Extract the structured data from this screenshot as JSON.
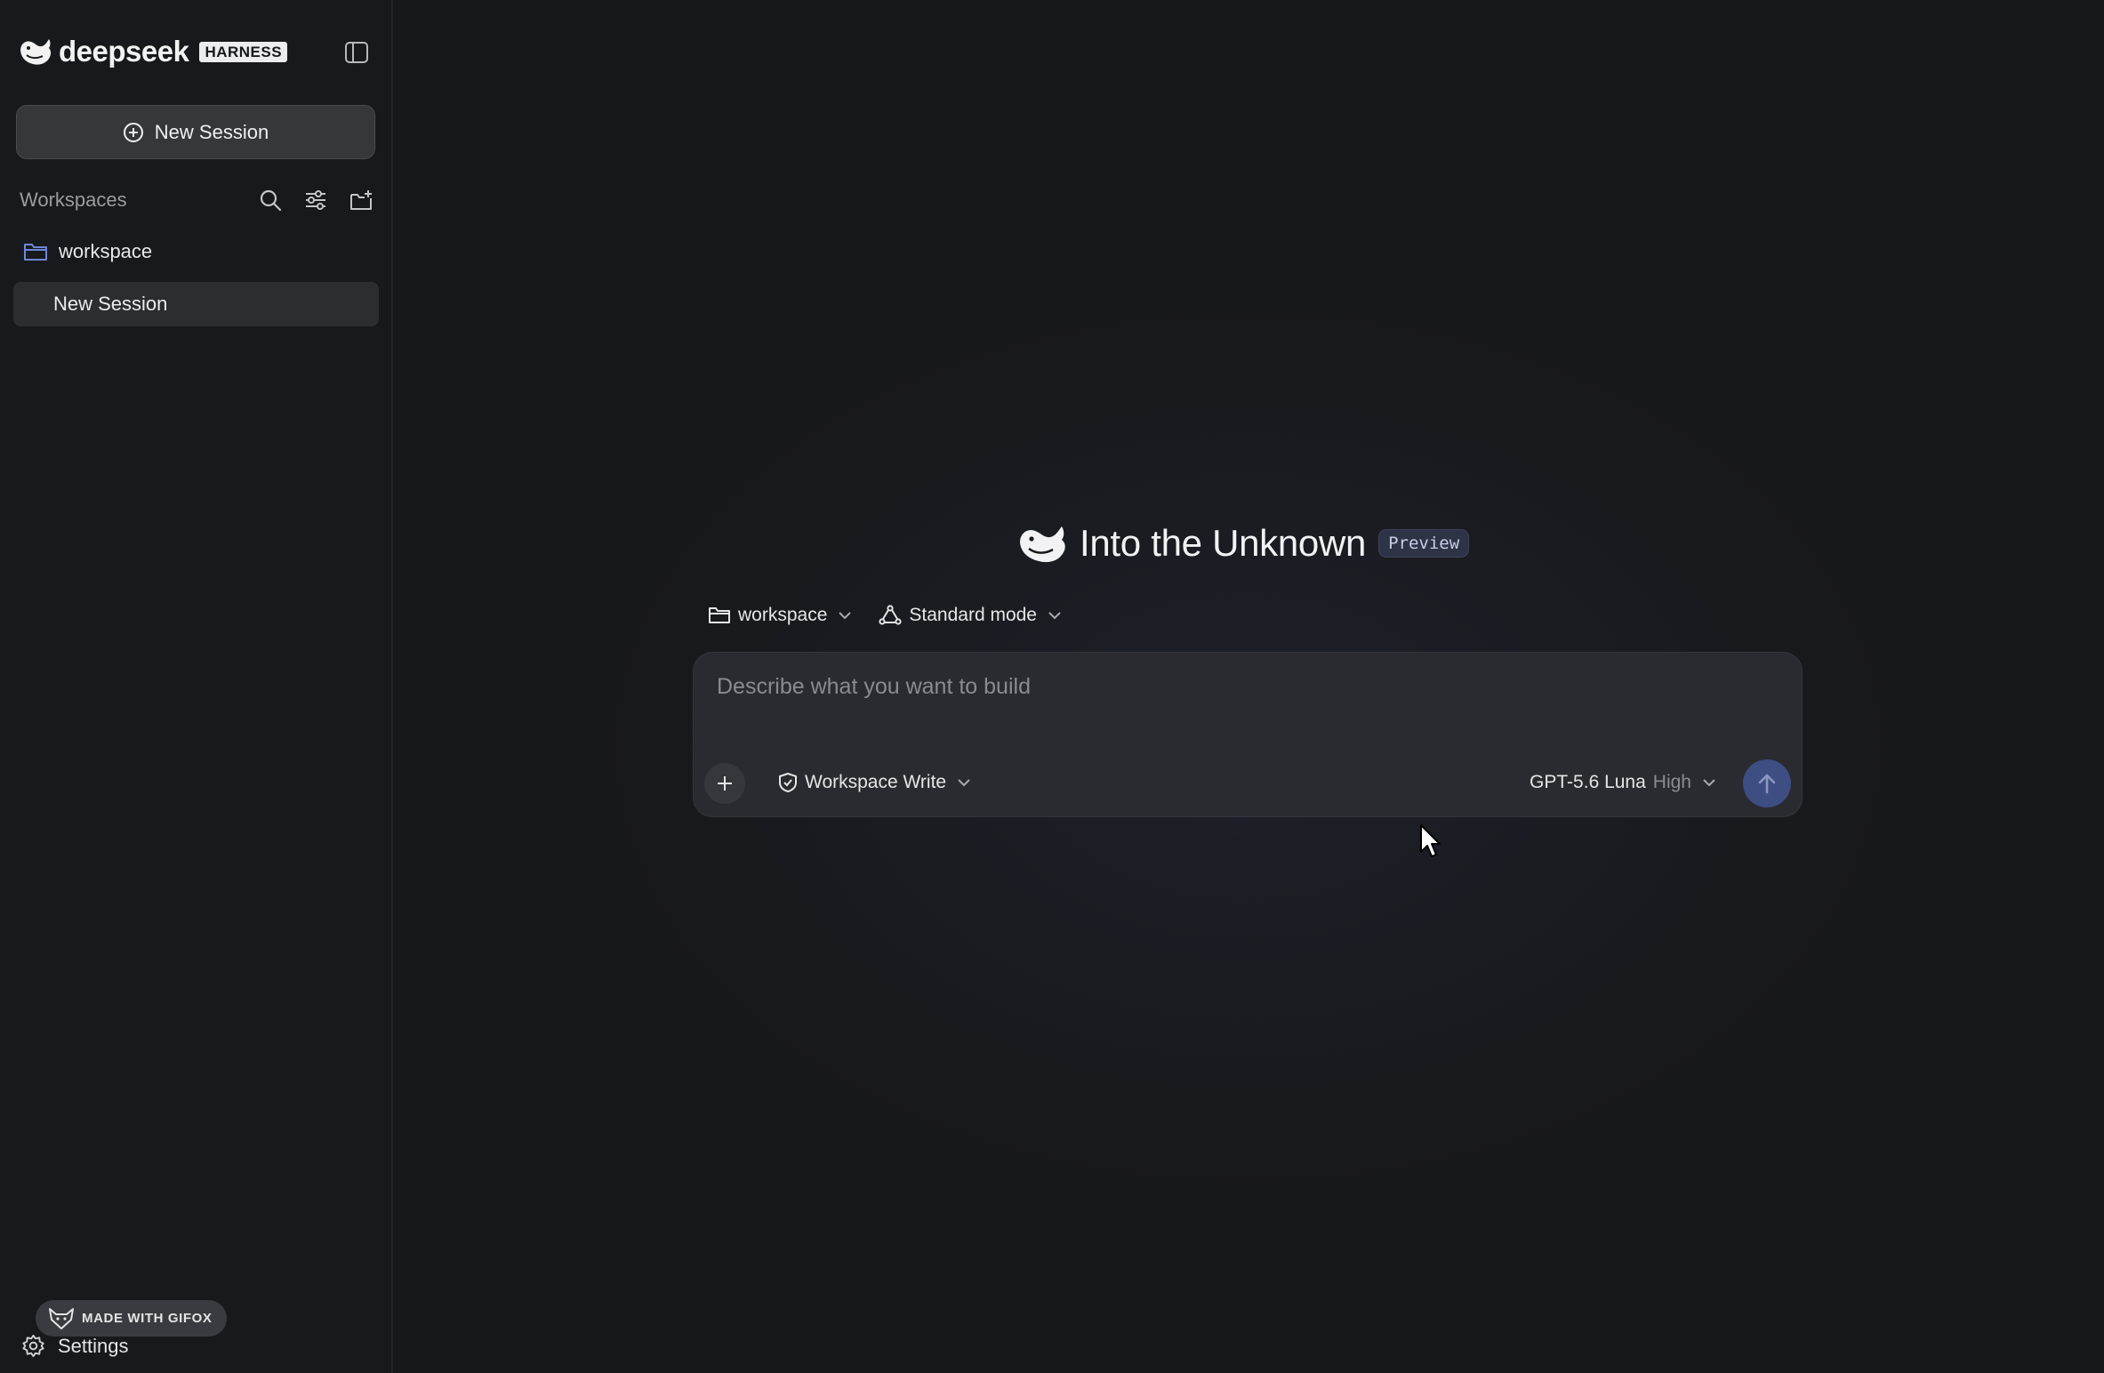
{
  "sidebar": {
    "brand_name": "deepseek",
    "brand_tag": "HARNESS",
    "new_session_label": "New Session",
    "workspaces_title": "Workspaces",
    "workspace_folder": "workspace",
    "sessions": [
      {
        "label": "New Session",
        "selected": true
      }
    ],
    "gifox_badge": "MADE WITH GIFOX",
    "settings_label": "Settings"
  },
  "main": {
    "title": "Into the Unknown",
    "badge": "Preview",
    "workspace_selector": "workspace",
    "mode_selector": "Standard mode",
    "composer": {
      "placeholder": "Describe what you want to build",
      "permission": "Workspace Write",
      "model": "GPT-5.6 Luna",
      "effort": "High"
    }
  },
  "colors": {
    "background": "#17181b",
    "sidebar": "#18191c",
    "composer": "#2a2b30",
    "accent_send": "#3e4d82",
    "folder_icon": "#6f86d6"
  }
}
